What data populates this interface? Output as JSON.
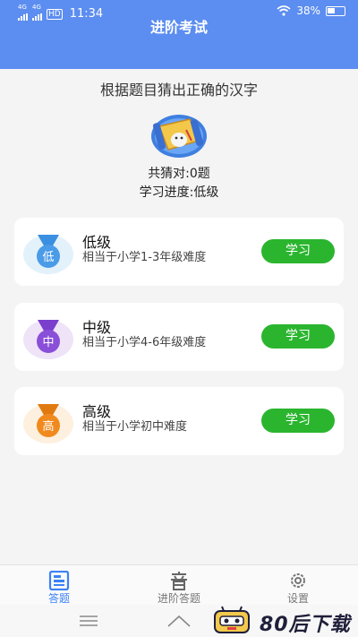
{
  "status": {
    "signal_a": "4G",
    "signal_b": "4G",
    "hd": "HD",
    "time": "11:34",
    "battery": "38%"
  },
  "header": {
    "title": "进阶考试"
  },
  "intro": {
    "subtitle": "根据题目猜出正确的汉字",
    "correct_count": "共猜对:0题",
    "progress": "学习进度:低级"
  },
  "levels": [
    {
      "badge": "低",
      "name": "低级",
      "desc": "相当于小学1-3年级难度",
      "button": "学习",
      "color": "#4a9be8",
      "ring": "#e3f1fb"
    },
    {
      "badge": "中",
      "name": "中级",
      "desc": "相当于小学4-6年级难度",
      "button": "学习",
      "color": "#8a4fd8",
      "ring": "#efe3f8"
    },
    {
      "badge": "高",
      "name": "高级",
      "desc": "相当于小学初中难度",
      "button": "学习",
      "color": "#f08a1e",
      "ring": "#fdf0df"
    }
  ],
  "tabs": [
    {
      "label": "答题",
      "icon": "quiz-icon",
      "active": true
    },
    {
      "label": "进阶答题",
      "icon": "sound-char-icon",
      "active": false
    },
    {
      "label": "设置",
      "icon": "gear-icon",
      "active": false
    }
  ],
  "watermark": {
    "text": "80后下载"
  },
  "colors": {
    "header": "#5c8df0",
    "button": "#2bb52f",
    "active_tab": "#3b82f6"
  }
}
